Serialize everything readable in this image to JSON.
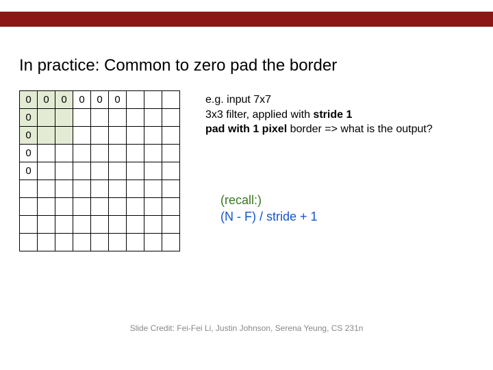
{
  "title": "In practice: Common to zero pad the border",
  "grid": {
    "rows": 9,
    "cols": 9,
    "filter_cells": [
      [
        0,
        0
      ],
      [
        0,
        1
      ],
      [
        0,
        2
      ],
      [
        1,
        0
      ],
      [
        1,
        1
      ],
      [
        1,
        2
      ],
      [
        2,
        0
      ],
      [
        2,
        1
      ],
      [
        2,
        2
      ]
    ],
    "labels": {
      "0,0": "0",
      "0,1": "0",
      "0,2": "0",
      "0,3": "0",
      "0,4": "0",
      "0,5": "0",
      "1,0": "0",
      "2,0": "0",
      "3,0": "0",
      "4,0": "0"
    }
  },
  "explain": {
    "line1": "e.g. input 7x7",
    "line2a": "3x3 filter, applied with ",
    "line2b": "stride 1",
    "line3a": "pad with 1 pixel",
    "line3b": " border => what is the output?"
  },
  "formula": {
    "recall": "(recall:)",
    "eqn": "(N - F) / stride + 1"
  },
  "credit": "Slide Credit: Fei-Fei Li, Justin Johnson, Serena Yeung, CS 231n"
}
